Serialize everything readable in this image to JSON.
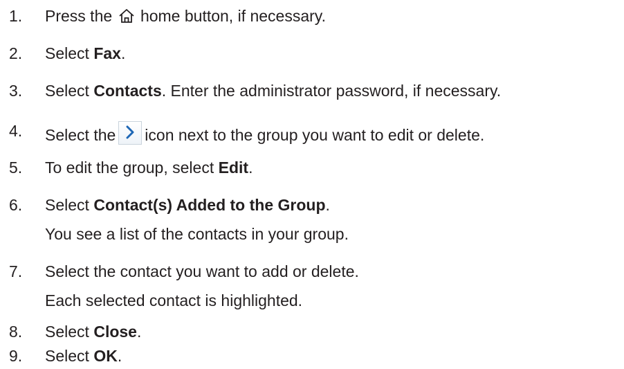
{
  "steps": [
    {
      "num": "1.",
      "pre": "Press the",
      "icon": "home-icon",
      "post": "home button, if necessary."
    },
    {
      "num": "2.",
      "pre": "Select ",
      "bold": "Fax",
      "post": "."
    },
    {
      "num": "3.",
      "pre": "Select ",
      "bold": "Contacts",
      "post": ". Enter the administrator password, if necessary."
    },
    {
      "num": "4.",
      "pre": "Select the",
      "icon": "chevron-right-icon",
      "post": "icon next to the group you want to edit or delete."
    },
    {
      "num": "5.",
      "pre": "To edit the group, select ",
      "bold": "Edit",
      "post": "."
    },
    {
      "num": "6.",
      "pre": "Select ",
      "bold": "Contact(s) Added to the Group",
      "post": ".",
      "note": "You see a list of the contacts in your group."
    },
    {
      "num": "7.",
      "pre": "Select the contact you want to add or delete.",
      "note": "Each selected contact is highlighted."
    },
    {
      "num": "8.",
      "pre": "Select ",
      "bold": "Close",
      "post": "."
    },
    {
      "num": "9.",
      "pre": "Select ",
      "bold": "OK",
      "post": "."
    }
  ]
}
